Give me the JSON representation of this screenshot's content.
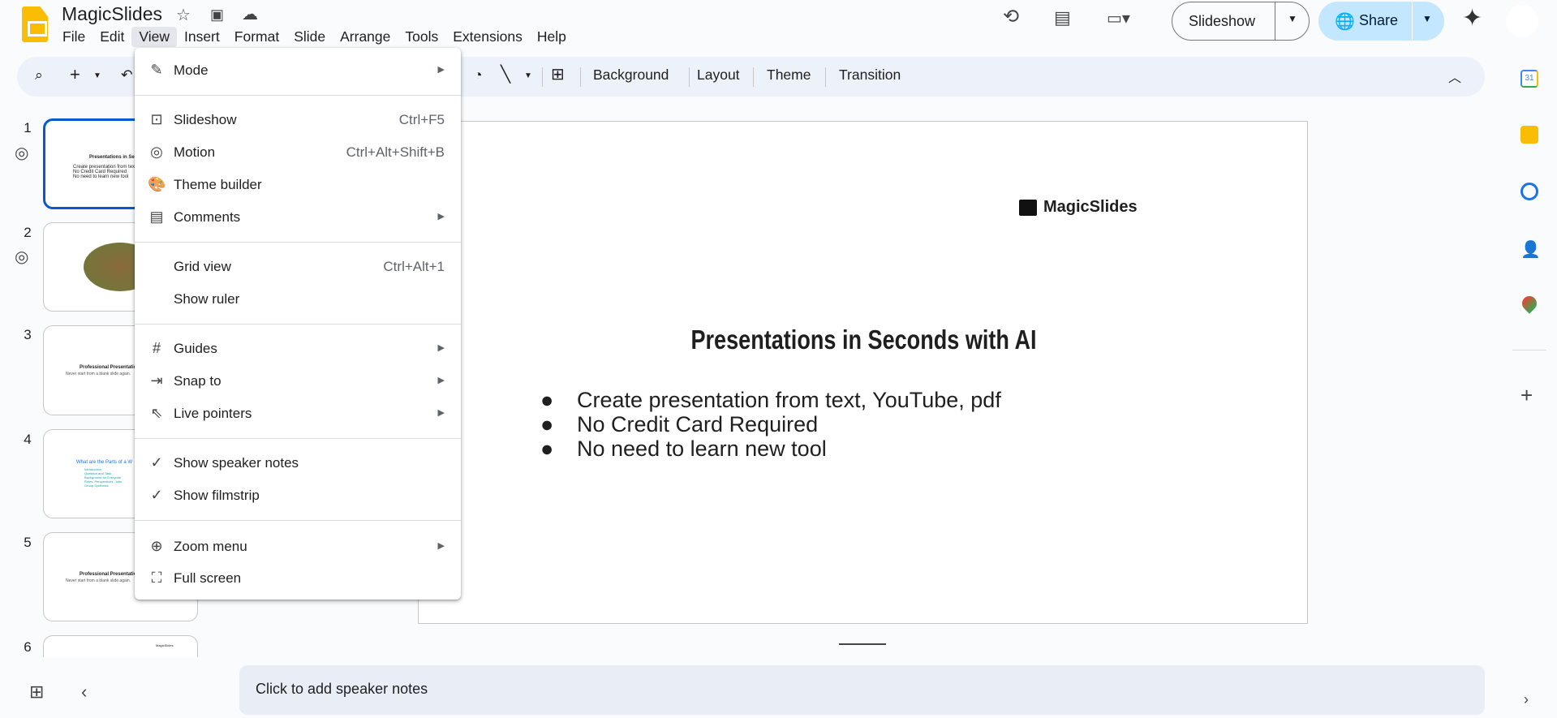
{
  "app": {
    "title": "MagicSlides"
  },
  "menubar": [
    "File",
    "Edit",
    "View",
    "Insert",
    "Format",
    "Slide",
    "Arrange",
    "Tools",
    "Extensions",
    "Help"
  ],
  "toolbar": {
    "background": "Background",
    "layout": "Layout",
    "theme": "Theme",
    "transition": "Transition"
  },
  "header": {
    "slideshow": "Slideshow",
    "share": "Share"
  },
  "view_menu": {
    "mode": "Mode",
    "slideshow": "Slideshow",
    "slideshow_sc": "Ctrl+F5",
    "motion": "Motion",
    "motion_sc": "Ctrl+Alt+Shift+B",
    "theme_builder": "Theme builder",
    "comments": "Comments",
    "grid_view": "Grid view",
    "grid_view_sc": "Ctrl+Alt+1",
    "show_ruler": "Show ruler",
    "guides": "Guides",
    "snap_to": "Snap to",
    "live_pointers": "Live pointers",
    "show_speaker_notes": "Show speaker notes",
    "show_filmstrip": "Show filmstrip",
    "zoom_menu": "Zoom menu",
    "full_screen": "Full screen"
  },
  "filmstrip": {
    "numbers": [
      "1",
      "2",
      "3",
      "4",
      "5",
      "6"
    ],
    "t1": {
      "title": "Presentations in Seconds with AI",
      "b": [
        "Create presentation from text, YouTube, pdf",
        "No Credit Card Required",
        "No need to learn new tool"
      ]
    },
    "t3": {
      "title": "Professional Presentations in Seconds",
      "sub": "Never start from a blank slide again."
    },
    "t4": {
      "title": "What are the Parts of a W",
      "b": [
        "Introduction",
        "Question and Task",
        "Background for Everyone",
        "Roles, Perspectives, Jobs",
        "Group Synthesis"
      ]
    },
    "t6": {
      "logo": "MagicSlides"
    }
  },
  "slide": {
    "logo": "MagicSlides",
    "title": "Presentations in Seconds with AI",
    "bullets": [
      "Create presentation from text, YouTube, pdf",
      "No Credit Card Required",
      "No need to learn new tool"
    ]
  },
  "notes": {
    "placeholder": "Click to add speaker notes"
  },
  "side_panel": {
    "calendar_day": "31"
  }
}
